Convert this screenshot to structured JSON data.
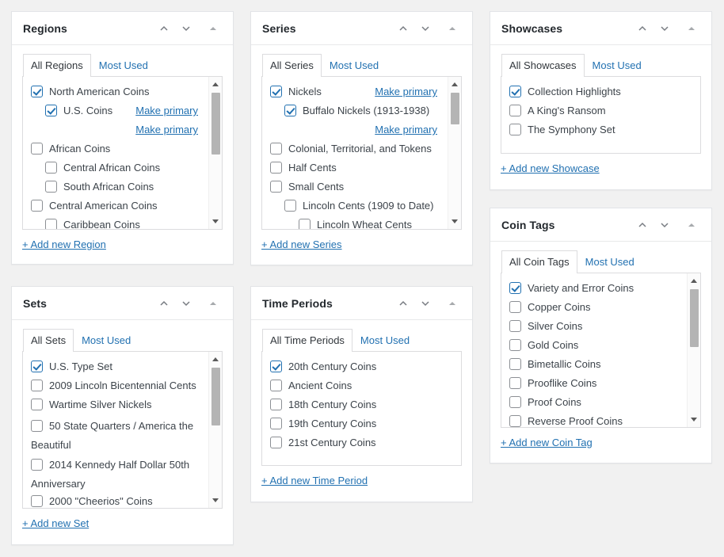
{
  "header_icons": {
    "move_up": "chevron-up-icon",
    "move_down": "chevron-down-icon",
    "collapse": "triangle-up-icon"
  },
  "colors": {
    "page_background": "#f1f1f1",
    "panel_background": "#ffffff",
    "panel_border": "#e2e4e7",
    "link": "#2271b1",
    "checkbox_checked": "#2271b1",
    "checkbox_unchecked_border": "#8c8f94",
    "text": "#3c434a",
    "title": "#23282d",
    "scrollbar_thumb": "#b4b4b4"
  },
  "panels": {
    "regions": {
      "title": "Regions",
      "tabs": [
        {
          "label": "All Regions",
          "active": true
        },
        {
          "label": "Most Used",
          "active": false
        }
      ],
      "items": [
        {
          "label": "North American Coins",
          "checked": true,
          "indent": 0,
          "make_primary": null
        },
        {
          "label": "U.S. Coins",
          "checked": true,
          "indent": 1,
          "make_primary": "Make primary"
        },
        {
          "label": "",
          "checked": null,
          "indent": 1,
          "make_primary": "Make primary"
        },
        {
          "label": "African Coins",
          "checked": false,
          "indent": 0,
          "make_primary": null
        },
        {
          "label": "Central African Coins",
          "checked": false,
          "indent": 1,
          "make_primary": null
        },
        {
          "label": "South African Coins",
          "checked": false,
          "indent": 1,
          "make_primary": null
        },
        {
          "label": "Central American Coins",
          "checked": false,
          "indent": 0,
          "make_primary": null
        },
        {
          "label": "Caribbean Coins",
          "checked": false,
          "indent": 1,
          "make_primary": null
        }
      ],
      "add_new": "+ Add new Region",
      "has_scrollbar": true
    },
    "series": {
      "title": "Series",
      "tabs": [
        {
          "label": "All Series",
          "active": true
        },
        {
          "label": "Most Used",
          "active": false
        }
      ],
      "items": [
        {
          "label": "Nickels",
          "checked": true,
          "indent": 0,
          "make_primary": "Make primary"
        },
        {
          "label": "Buffalo Nickels (1913-1938)",
          "checked": true,
          "indent": 1,
          "make_primary": null
        },
        {
          "label": "",
          "checked": null,
          "indent": 1,
          "make_primary": "Make primary"
        },
        {
          "label": "Colonial, Territorial, and Tokens",
          "checked": false,
          "indent": 0,
          "make_primary": null
        },
        {
          "label": "Half Cents",
          "checked": false,
          "indent": 0,
          "make_primary": null
        },
        {
          "label": "Small Cents",
          "checked": false,
          "indent": 0,
          "make_primary": null
        },
        {
          "label": "Lincoln Cents (1909 to Date)",
          "checked": false,
          "indent": 1,
          "make_primary": null
        },
        {
          "label": "Lincoln Wheat Cents",
          "checked": false,
          "indent": 2,
          "make_primary": null
        }
      ],
      "add_new": "+ Add new Series",
      "has_scrollbar": true
    },
    "showcases": {
      "title": "Showcases",
      "tabs": [
        {
          "label": "All Showcases",
          "active": true
        },
        {
          "label": "Most Used",
          "active": false
        }
      ],
      "items": [
        {
          "label": "Collection Highlights",
          "checked": true,
          "indent": 0,
          "make_primary": null
        },
        {
          "label": "A King's Ransom",
          "checked": false,
          "indent": 0,
          "make_primary": null
        },
        {
          "label": "The Symphony Set",
          "checked": false,
          "indent": 0,
          "make_primary": null
        }
      ],
      "add_new": "+ Add new Showcase",
      "has_scrollbar": false
    },
    "coin_tags": {
      "title": "Coin Tags",
      "tabs": [
        {
          "label": "All Coin Tags",
          "active": true
        },
        {
          "label": "Most Used",
          "active": false
        }
      ],
      "items": [
        {
          "label": "Variety and Error Coins",
          "checked": true,
          "indent": 0,
          "make_primary": null
        },
        {
          "label": "Copper Coins",
          "checked": false,
          "indent": 0,
          "make_primary": null
        },
        {
          "label": "Silver Coins",
          "checked": false,
          "indent": 0,
          "make_primary": null
        },
        {
          "label": "Gold Coins",
          "checked": false,
          "indent": 0,
          "make_primary": null
        },
        {
          "label": "Bimetallic Coins",
          "checked": false,
          "indent": 0,
          "make_primary": null
        },
        {
          "label": "Prooflike Coins",
          "checked": false,
          "indent": 0,
          "make_primary": null
        },
        {
          "label": "Proof Coins",
          "checked": false,
          "indent": 0,
          "make_primary": null
        },
        {
          "label": "Reverse Proof Coins",
          "checked": false,
          "indent": 0,
          "make_primary": null
        }
      ],
      "add_new": "+ Add new Coin Tag",
      "has_scrollbar": true
    },
    "sets": {
      "title": "Sets",
      "tabs": [
        {
          "label": "All Sets",
          "active": true
        },
        {
          "label": "Most Used",
          "active": false
        }
      ],
      "items": [
        {
          "label": "U.S. Type Set",
          "checked": true,
          "indent": 0,
          "make_primary": null
        },
        {
          "label": "2009 Lincoln Bicentennial Cents",
          "checked": false,
          "indent": 0,
          "make_primary": null
        },
        {
          "label": "Wartime Silver Nickels",
          "checked": false,
          "indent": 0,
          "make_primary": null
        },
        {
          "label": "50 State Quarters / America the Beautiful",
          "checked": false,
          "indent": 0,
          "make_primary": null
        },
        {
          "label": "2014 Kennedy Half Dollar 50th Anniversary",
          "checked": false,
          "indent": 0,
          "make_primary": null
        },
        {
          "label": "2000 \"Cheerios\" Coins",
          "checked": false,
          "indent": 0,
          "make_primary": null
        }
      ],
      "add_new": "+ Add new Set",
      "has_scrollbar": true
    },
    "time_periods": {
      "title": "Time Periods",
      "tabs": [
        {
          "label": "All Time Periods",
          "active": true
        },
        {
          "label": "Most Used",
          "active": false
        }
      ],
      "items": [
        {
          "label": "20th Century Coins",
          "checked": true,
          "indent": 0,
          "make_primary": null
        },
        {
          "label": "Ancient Coins",
          "checked": false,
          "indent": 0,
          "make_primary": null
        },
        {
          "label": "18th Century Coins",
          "checked": false,
          "indent": 0,
          "make_primary": null
        },
        {
          "label": "19th Century Coins",
          "checked": false,
          "indent": 0,
          "make_primary": null
        },
        {
          "label": "21st Century Coins",
          "checked": false,
          "indent": 0,
          "make_primary": null
        }
      ],
      "add_new": "+ Add new Time Period",
      "has_scrollbar": false
    }
  }
}
